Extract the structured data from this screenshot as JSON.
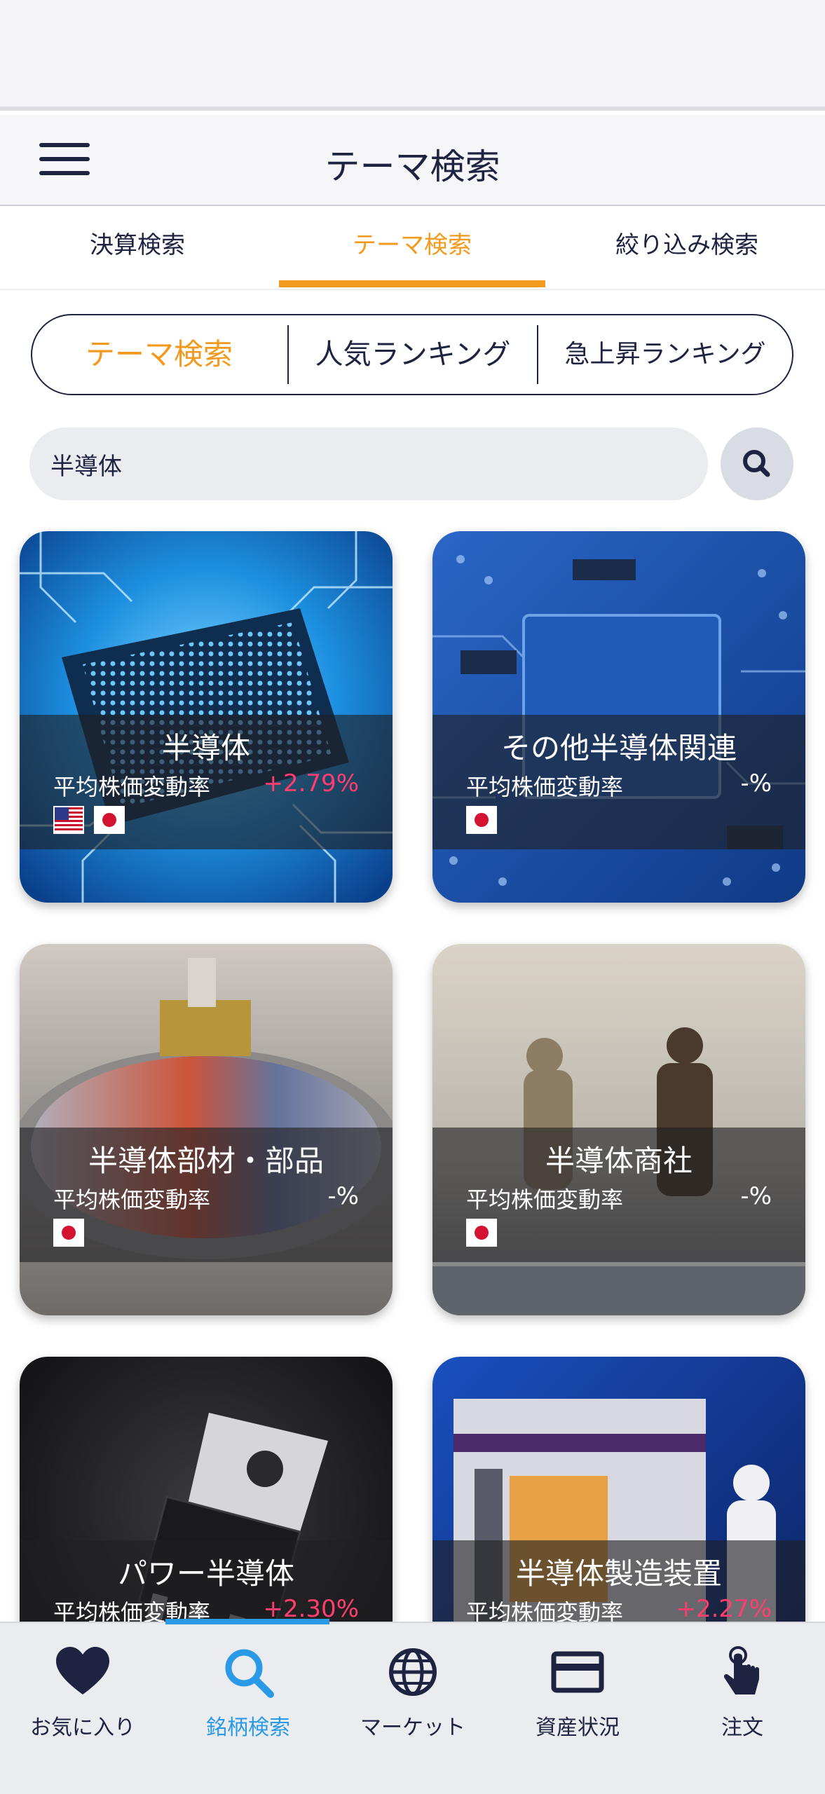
{
  "header": {
    "title": "テーマ検索"
  },
  "tabs": [
    {
      "label": "決算検索",
      "active": false
    },
    {
      "label": "テーマ検索",
      "active": true
    },
    {
      "label": "絞り込み検索",
      "active": false
    }
  ],
  "segments": [
    {
      "label": "テーマ検索",
      "active": true
    },
    {
      "label": "人気ランキング",
      "active": false
    },
    {
      "label": "急上昇ランキング",
      "active": false
    }
  ],
  "search": {
    "value": "半導体",
    "button_icon": "search-icon"
  },
  "themes": [
    {
      "name": "半導体",
      "rate_label": "平均株価変動率",
      "rate": "+2.79%",
      "flags": [
        "us-flag",
        "jp-flag"
      ]
    },
    {
      "name": "その他半導体関連",
      "rate_label": "平均株価変動率",
      "rate": "-%",
      "flags": [
        "jp-flag"
      ]
    },
    {
      "name": "半導体部材・部品",
      "rate_label": "平均株価変動率",
      "rate": "-%",
      "flags": [
        "jp-flag"
      ]
    },
    {
      "name": "半導体商社",
      "rate_label": "平均株価変動率",
      "rate": "-%",
      "flags": [
        "jp-flag"
      ]
    },
    {
      "name": "パワー半導体",
      "rate_label": "平均株価変動率",
      "rate": "+2.30%",
      "flags": []
    },
    {
      "name": "半導体製造装置",
      "rate_label": "平均株価変動率",
      "rate": "+2.27%",
      "flags": []
    }
  ],
  "bottom_nav": [
    {
      "label": "お気に入り",
      "icon": "heart-icon",
      "active": false
    },
    {
      "label": "銘柄検索",
      "icon": "search-icon",
      "active": true
    },
    {
      "label": "マーケット",
      "icon": "globe-icon",
      "active": false
    },
    {
      "label": "資産状況",
      "icon": "card-icon",
      "active": false
    },
    {
      "label": "注文",
      "icon": "tap-hand-icon",
      "active": false
    }
  ],
  "colors": {
    "accent_orange": "#f39a1e",
    "accent_blue": "#2a9ae6",
    "rate_up": "#ff3d6e",
    "navy": "#1d2340"
  }
}
